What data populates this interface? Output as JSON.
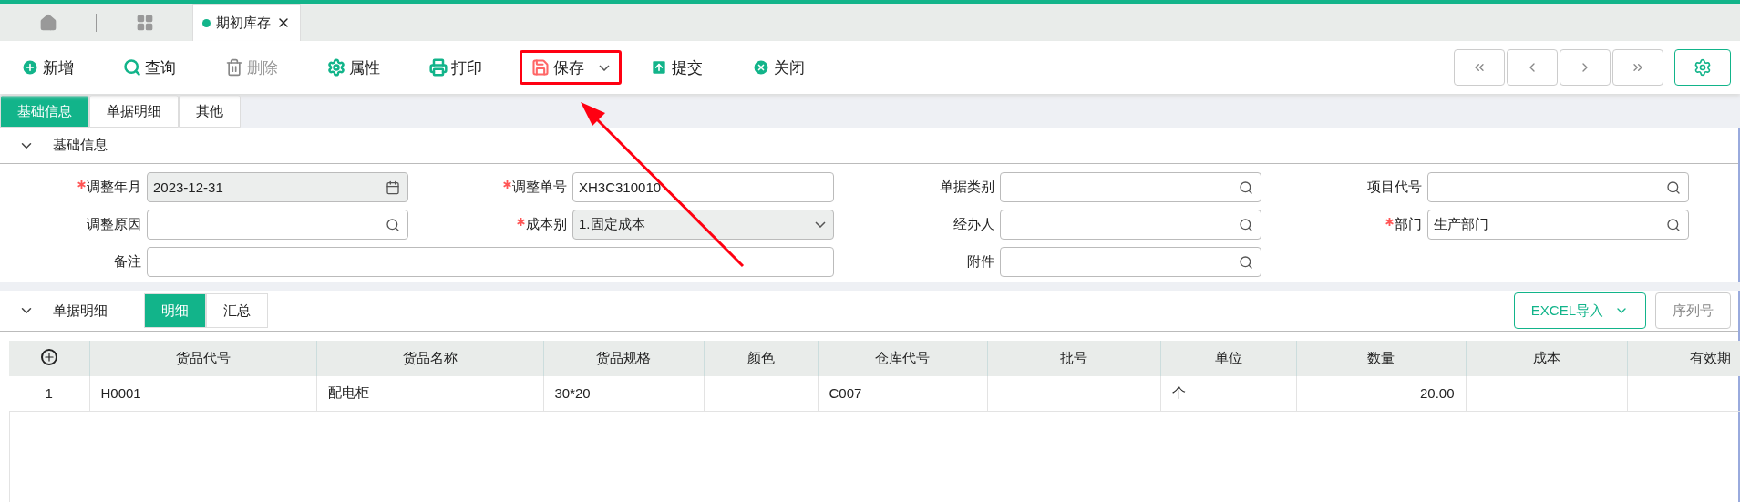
{
  "page_tabs": [
    {
      "label": "期初库存",
      "selected": true
    }
  ],
  "toolbar": [
    {
      "kind": "add",
      "label": "新增",
      "disabled": false,
      "highlighted": false,
      "dropdown": false
    },
    {
      "kind": "query",
      "label": "查询",
      "disabled": false,
      "highlighted": false,
      "dropdown": false
    },
    {
      "kind": "delete",
      "label": "删除",
      "disabled": true,
      "highlighted": false,
      "dropdown": false
    },
    {
      "kind": "properties",
      "label": "属性",
      "disabled": false,
      "highlighted": false,
      "dropdown": false
    },
    {
      "kind": "print",
      "label": "打印",
      "disabled": false,
      "highlighted": false,
      "dropdown": false
    },
    {
      "kind": "save",
      "label": "保存",
      "disabled": false,
      "highlighted": true,
      "dropdown": true
    },
    {
      "kind": "submit",
      "label": "提交",
      "disabled": false,
      "highlighted": false,
      "dropdown": false
    },
    {
      "kind": "close",
      "label": "关闭",
      "disabled": false,
      "highlighted": false,
      "dropdown": false
    }
  ],
  "annotation_arrow": true,
  "section_tabs": [
    {
      "label": "基础信息",
      "selected": true
    },
    {
      "label": "单据明细",
      "selected": false
    },
    {
      "label": "其他",
      "selected": false
    }
  ],
  "basic_section": {
    "title": "基础信息",
    "expanded": true,
    "fields": [
      {
        "label": "调整年月",
        "required": true,
        "kind": "date",
        "value": "2023-12-31"
      },
      {
        "label": "调整单号",
        "required": true,
        "kind": "text",
        "value": "XH3C310010"
      },
      {
        "label": "单据类别",
        "required": false,
        "kind": "lookup"
      },
      {
        "label": "项目代号",
        "required": false,
        "kind": "lookup"
      },
      {
        "label": "调整原因",
        "required": false,
        "kind": "lookup"
      },
      {
        "label": "成本别",
        "required": true,
        "kind": "select",
        "value": "1.固定成本"
      },
      {
        "label": "经办人",
        "required": false,
        "kind": "lookup"
      },
      {
        "label": "部门",
        "required": true,
        "kind": "lookup",
        "value": "生产部门"
      },
      {
        "label": "备注",
        "required": false,
        "kind": "wide"
      },
      {
        "label": "附件",
        "required": false,
        "kind": "lookup"
      }
    ]
  },
  "detail_section": {
    "title": "单据明细",
    "expanded": true,
    "views": [
      {
        "label": "明细",
        "selected": true
      },
      {
        "label": "汇总",
        "selected": false
      }
    ],
    "buttons": [
      {
        "label": "EXCEL导入",
        "kind": "dropdown"
      },
      {
        "label": "序列号",
        "kind": "plain"
      }
    ],
    "table": {
      "columns": [
        {
          "label": "货品代号",
          "kind": "text"
        },
        {
          "label": "货品名称",
          "kind": "text"
        },
        {
          "label": "货品规格",
          "kind": "text"
        },
        {
          "label": "颜色",
          "kind": "text"
        },
        {
          "label": "仓库代号",
          "kind": "text"
        },
        {
          "label": "批号",
          "kind": "text"
        },
        {
          "label": "单位",
          "kind": "text"
        },
        {
          "label": "数量",
          "kind": "number"
        },
        {
          "label": "成本",
          "kind": "number"
        },
        {
          "label": "有效期",
          "kind": "text"
        }
      ],
      "rows": [
        {
          "number": "1",
          "cells": [
            "H0001",
            "配电柜",
            "30*20",
            "",
            "C007",
            "",
            "个",
            "20.00",
            "",
            ""
          ]
        }
      ]
    }
  }
}
